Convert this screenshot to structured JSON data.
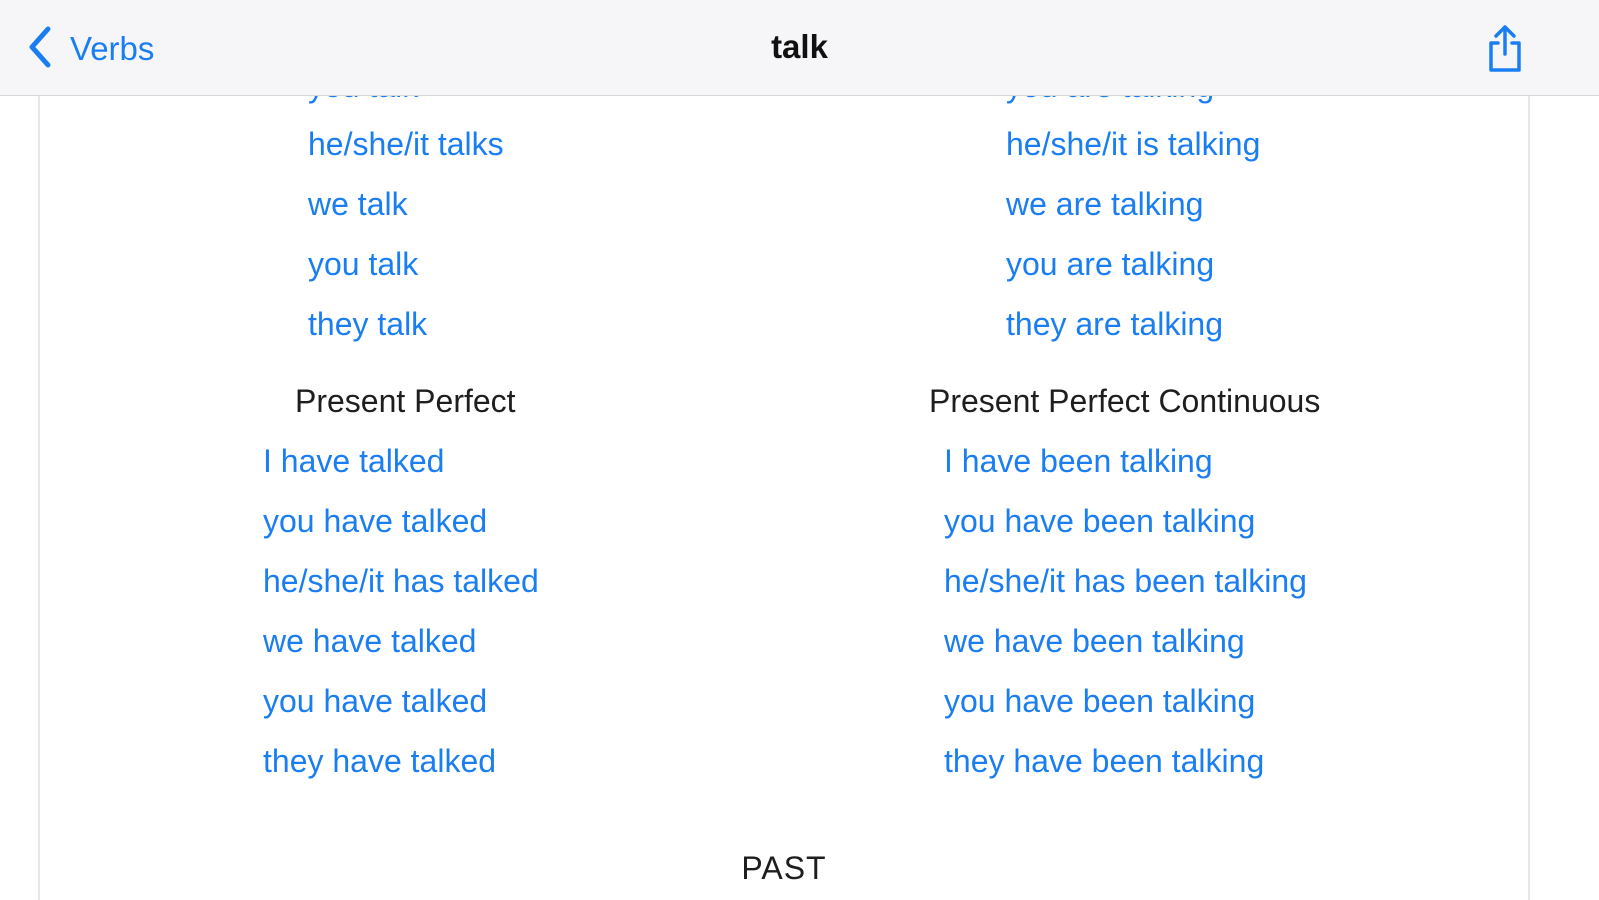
{
  "nav": {
    "back_label": "Verbs",
    "title": "talk"
  },
  "present_simple": {
    "items": [
      "he/she/it talks",
      "we talk",
      "you talk",
      "they talk"
    ]
  },
  "present_continuous": {
    "items": [
      "he/she/it is talking",
      "we are talking",
      "you are talking",
      "they are talking"
    ]
  },
  "present_perfect": {
    "heading": "Present Perfect",
    "items": [
      "I have talked",
      "you have talked",
      "he/she/it has talked",
      "we have talked",
      "you have talked",
      "they have talked"
    ]
  },
  "present_perfect_continuous": {
    "heading": "Present Perfect Continuous",
    "items": [
      "I have been talking",
      "you have been talking",
      "he/she/it has been talking",
      "we have been talking",
      "you have been talking",
      "they have been talking"
    ]
  },
  "next_section": {
    "heading": "PAST"
  },
  "colors": {
    "link": "#1a7ef2",
    "text": "#1e1e1e",
    "nav_bg": "#f6f6f8"
  }
}
